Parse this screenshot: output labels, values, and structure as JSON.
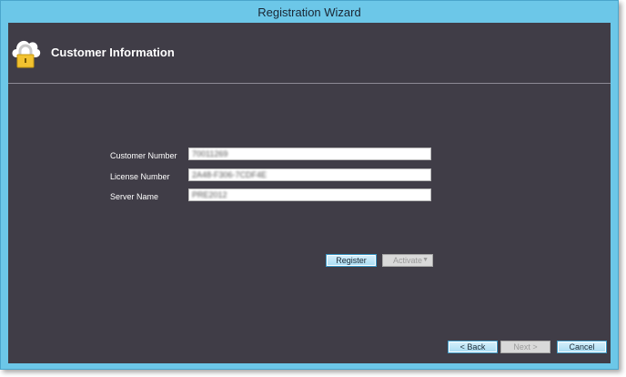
{
  "window": {
    "title": "Registration Wizard"
  },
  "header": {
    "title": "Customer Information",
    "icon": "cloud-lock-icon"
  },
  "form": {
    "customer_number": {
      "label": "Customer Number",
      "value": "70011269"
    },
    "license_number": {
      "label": "License Number",
      "value": "2A48-F306-7CDF4E"
    },
    "server_name": {
      "label": "Server Name",
      "value": "PRE2012"
    }
  },
  "actions": {
    "register": "Register",
    "activate": "Activate"
  },
  "nav": {
    "back": "< Back",
    "next": "Next >",
    "cancel": "Cancel"
  },
  "colors": {
    "titlebar": "#6cc7e8",
    "client": "#403d47",
    "accent": "#3e9cc9"
  }
}
